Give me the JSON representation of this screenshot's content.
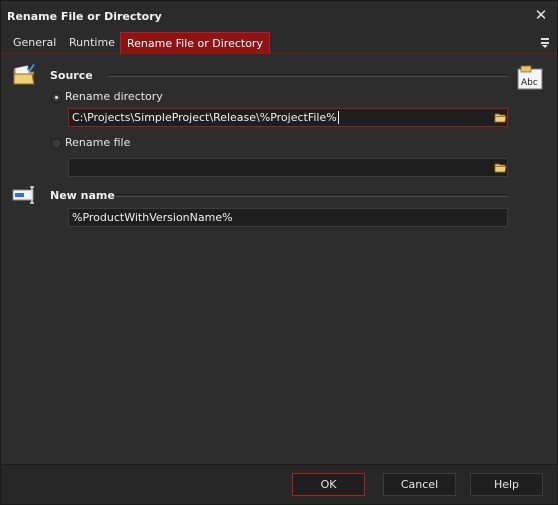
{
  "window": {
    "title": "Rename File or Directory",
    "close_glyph": "✕"
  },
  "tabs": [
    {
      "label": "General",
      "active": false
    },
    {
      "label": "Runtime",
      "active": false
    },
    {
      "label": "Rename File or Directory",
      "active": true
    }
  ],
  "source": {
    "label": "Source",
    "icon": "folder-check-icon",
    "options": [
      {
        "label": "Rename directory",
        "checked": true,
        "value": "C:\\Projects\\SimpleProject\\Release\\%ProjectFile%"
      },
      {
        "label": "Rename file",
        "checked": false,
        "value": ""
      }
    ]
  },
  "new_name": {
    "label": "New name",
    "icon": "rename-cursor-icon",
    "value": "%ProductWithVersionName%"
  },
  "header_icon": "abc-text-icon",
  "footer": {
    "ok": "OK",
    "cancel": "Cancel",
    "help": "Help"
  },
  "colors": {
    "accent": "#8e1414",
    "focus_border": "#9a1c1c",
    "field_bg": "#1e1e1e",
    "dialog_bg": "#2d2d2d"
  }
}
